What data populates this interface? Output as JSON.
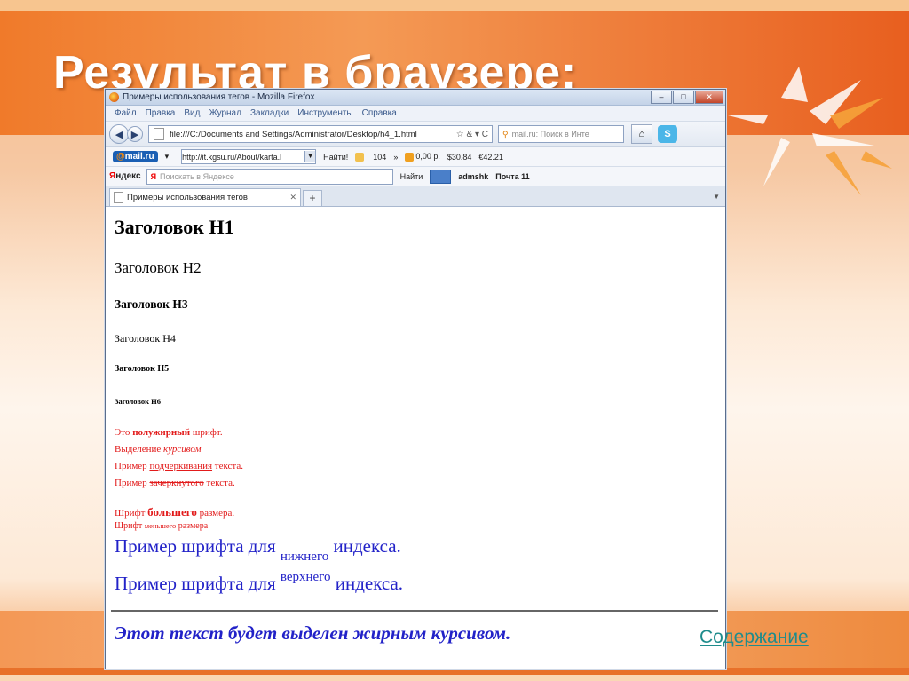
{
  "slide": {
    "title": "Результат в браузере:",
    "link": "Содержание",
    "colors": {
      "accent": "#f07a2a",
      "title_text": "#ffffff",
      "link": "#1f8c8c"
    }
  },
  "browser": {
    "window_title": "Примеры использования тегов - Mozilla Firefox",
    "menu": [
      "Файл",
      "Правка",
      "Вид",
      "Журнал",
      "Закладки",
      "Инструменты",
      "Справка"
    ],
    "url": "file:///C:/Documents and Settings/Administrator/Desktop/h4_1.html",
    "url_tail": "☆ & ▾ C",
    "search_placeholder": "mail.ru: Поиск в Инте",
    "mailbar": {
      "logo_at": "@",
      "logo_text": "mail.ru",
      "url": "http://it.kgsu.ru/About/karta.l",
      "find": "Найти!",
      "mail_count": "104",
      "money": "0,00 р.",
      "usd": "30.84",
      "eur": "42.21",
      "more": "»"
    },
    "yabar": {
      "logo_r": "Я",
      "logo_rest": "ндекс",
      "search_placeholder": "Поискать в Яндексе",
      "find": "Найти",
      "user": "admshk",
      "mail": "Почта 11"
    },
    "tab": {
      "label": "Примеры использования тегов"
    }
  },
  "page": {
    "h1": "Заголовок H1",
    "h2": "Заголовок H2",
    "h3": "Заголовок H3",
    "h4": "Заголовок H4",
    "h5": "Заголовок H5",
    "h6": "Заголовок H6",
    "bold_line": {
      "pre": "Это ",
      "bold": "полужирный",
      "post": " шрифт."
    },
    "italic_line": {
      "pre": "Выделение ",
      "italic": "курсивом"
    },
    "underline_line": {
      "pre": "Пример ",
      "underline": "подчеркивания",
      "post": " текста."
    },
    "strike_line": {
      "pre": "Пример ",
      "strike": "зачеркнутого",
      "post": " текста."
    },
    "big_line": {
      "pre": "Шрифт ",
      "big": "большего",
      "post": " размера."
    },
    "small_line": {
      "pre": "Шрифт ",
      "small": "меньшего",
      "post": " размера"
    },
    "sub_line": {
      "pre": "Пример шрифта для ",
      "sub": "нижнего",
      "post": " индекса."
    },
    "sup_line": {
      "pre": "Пример шрифта для ",
      "sup": "верхнего",
      "post": " индекса."
    },
    "bold_italic": "Этот текст будет выделен жирным курсивом."
  }
}
